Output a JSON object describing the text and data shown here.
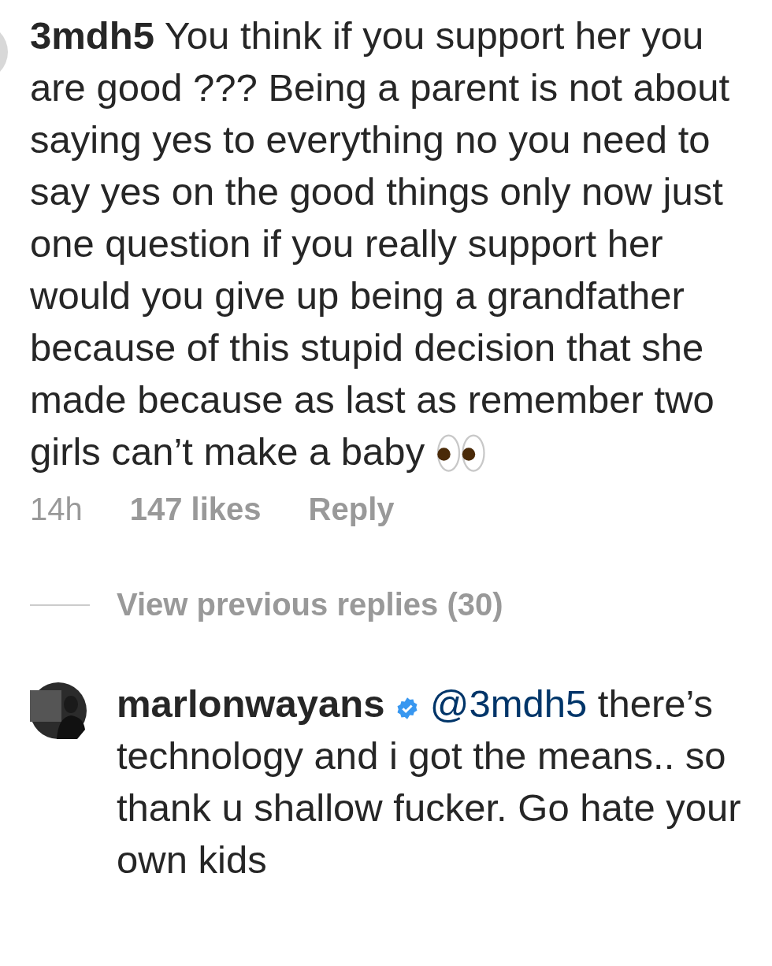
{
  "comment": {
    "username": "3mdh5",
    "text": "You think if you support her you are good ??? Being a parent is not about saying yes to everything no you need to say yes on the good things only now just one question if you really support her would you give up being a grandfather because of this stupid decision that she made because as last as remember two girls can’t make a baby",
    "time": "14h",
    "likes": "147 likes",
    "reply_label": "Reply"
  },
  "view_replies": "View previous replies (30)",
  "reply": {
    "username": "marlonwayans",
    "verified": true,
    "mention": "@3mdh5",
    "text": "there’s technology and i got the means.. so thank u shallow fucker. Go hate your own kids"
  }
}
